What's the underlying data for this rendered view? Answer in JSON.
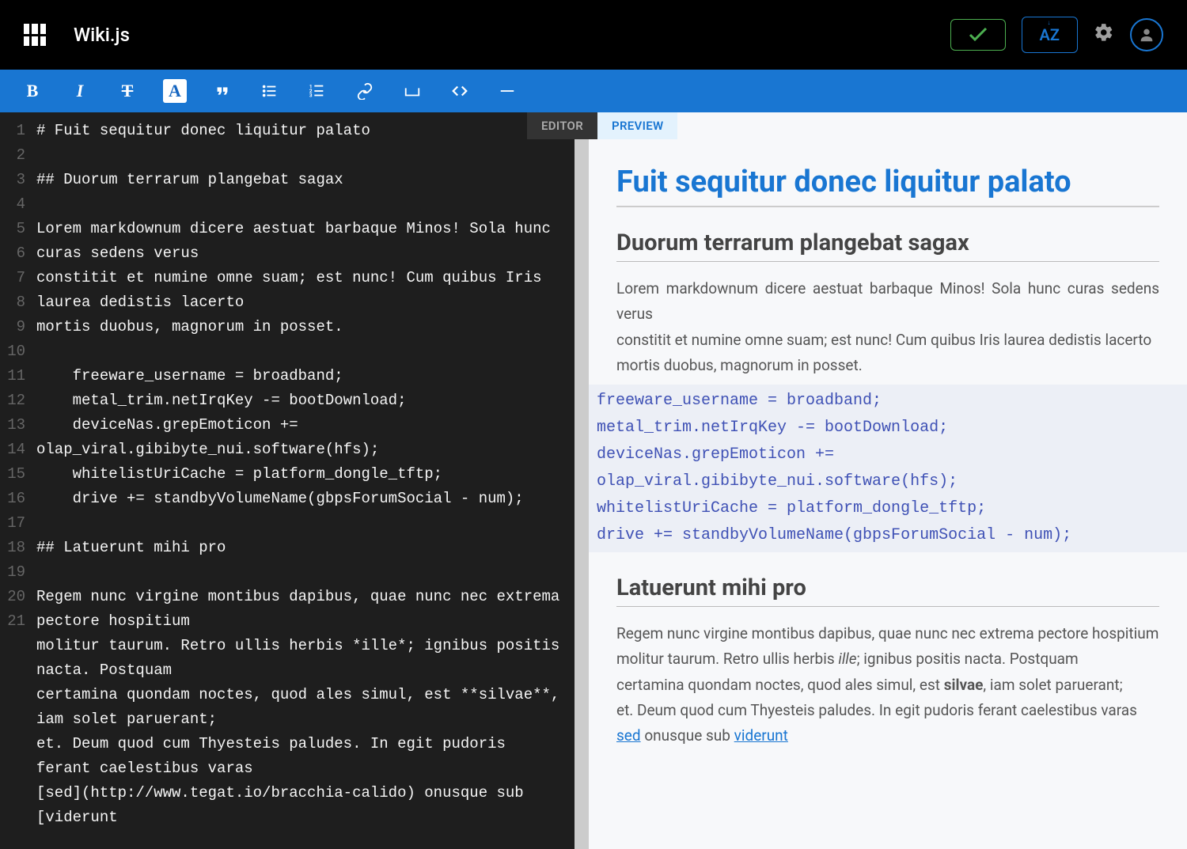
{
  "header": {
    "appTitle": "Wiki.js",
    "azLabel": "AZ"
  },
  "tabs": {
    "editor": "EDITOR",
    "preview": "PREVIEW"
  },
  "editor": {
    "lines": [
      "# Fuit sequitur donec liquitur palato",
      "",
      "## Duorum terrarum plangebat sagax",
      "",
      "Lorem markdownum dicere aestuat barbaque Minos! Sola hunc curas sedens verus",
      "constitit et numine omne suam; est nunc! Cum quibus Iris laurea dedistis lacerto",
      "mortis duobus, magnorum in posset.",
      "",
      "    freeware_username = broadband;",
      "    metal_trim.netIrqKey -= bootDownload;",
      "    deviceNas.grepEmoticon += olap_viral.gibibyte_nui.software(hfs);",
      "    whitelistUriCache = platform_dongle_tftp;",
      "    drive += standbyVolumeName(gbpsForumSocial - num);",
      "",
      "## Latuerunt mihi pro",
      "",
      "Regem nunc virgine montibus dapibus, quae nunc nec extrema pectore hospitium",
      "molitur taurum. Retro ullis herbis *ille*; ignibus positis nacta. Postquam",
      "certamina quondam noctes, quod ales simul, est **silvae**, iam solet paruerant;",
      "et. Deum quod cum Thyesteis paludes. In egit pudoris ferant caelestibus varas",
      "[sed](http://www.tegat.io/bracchia-calido) onusque sub [viderunt"
    ],
    "lineNumbers": [
      "1",
      "2",
      "3",
      "4",
      "5",
      "6",
      "7",
      "8",
      "9",
      "10",
      "11",
      "12",
      "13",
      "14",
      "15",
      "16",
      "17",
      "18",
      "19",
      "20",
      "21"
    ]
  },
  "preview": {
    "h1": "Fuit sequitur donec liquitur palato",
    "h2a": "Duorum terrarum plangebat sagax",
    "p1": "Lorem markdownum dicere aestuat barbaque Minos! Sola hunc curas sedens verus",
    "p1b": "constitit et numine omne suam; est nunc! Cum quibus Iris laurea dedistis lacerto",
    "p1c": "mortis duobus, magnorum in posset.",
    "code": "freeware_username = broadband;\nmetal_trim.netIrqKey -= bootDownload;\ndeviceNas.grepEmoticon += olap_viral.gibibyte_nui.software(hfs);\nwhitelistUriCache = platform_dongle_tftp;\ndrive += standbyVolumeName(gbpsForumSocial - num);",
    "h2b": "Latuerunt mihi pro",
    "p2": "Regem nunc virgine montibus dapibus, quae nunc nec extrema pectore hospitium",
    "p2b_pre": "molitur taurum. Retro ullis herbis ",
    "p2b_em": "ille",
    "p2b_post": "; ignibus positis nacta. Postquam",
    "p2c_pre": "certamina quondam noctes, quod ales simul, est ",
    "p2c_strong": "silvae",
    "p2c_post": ", iam solet paruerant;",
    "p2d": "et. Deum quod cum Thyesteis paludes. In egit pudoris ferant caelestibus varas",
    "link1": "sed",
    "p2e_mid": " onusque sub ",
    "link2": "viderunt"
  }
}
